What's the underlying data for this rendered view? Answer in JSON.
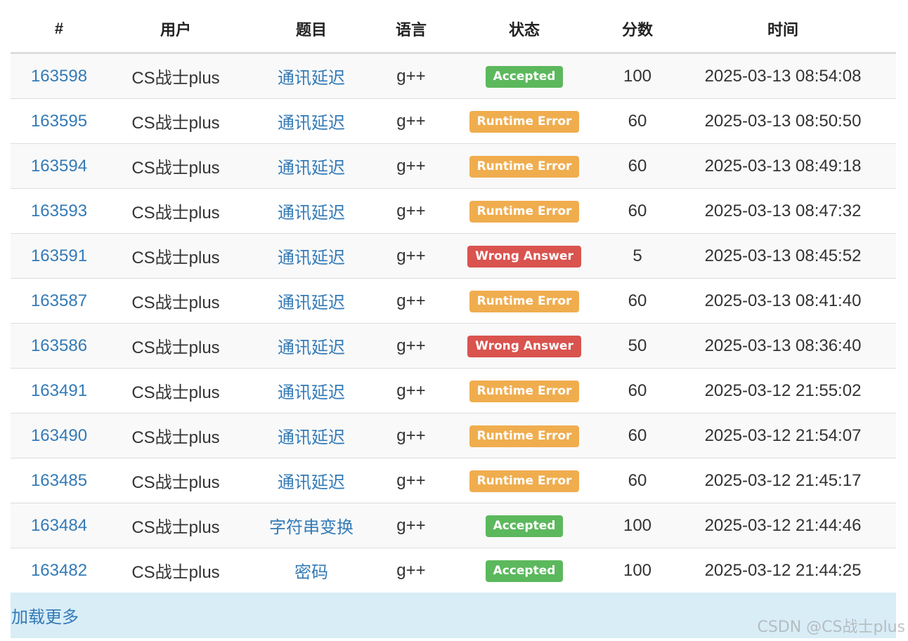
{
  "columns": [
    "#",
    "用户",
    "题目",
    "语言",
    "状态",
    "分数",
    "时间"
  ],
  "colors": {
    "Accepted": "#5cb85c",
    "Runtime Error": "#f0ad4e",
    "Wrong Answer": "#d9534f"
  },
  "rows": [
    {
      "id": "163598",
      "user": "CS战士plus",
      "problem": "通讯延迟",
      "lang": "g++",
      "status": "Accepted",
      "score": "100",
      "time": "2025-03-13 08:54:08"
    },
    {
      "id": "163595",
      "user": "CS战士plus",
      "problem": "通讯延迟",
      "lang": "g++",
      "status": "Runtime Error",
      "score": "60",
      "time": "2025-03-13 08:50:50"
    },
    {
      "id": "163594",
      "user": "CS战士plus",
      "problem": "通讯延迟",
      "lang": "g++",
      "status": "Runtime Error",
      "score": "60",
      "time": "2025-03-13 08:49:18"
    },
    {
      "id": "163593",
      "user": "CS战士plus",
      "problem": "通讯延迟",
      "lang": "g++",
      "status": "Runtime Error",
      "score": "60",
      "time": "2025-03-13 08:47:32"
    },
    {
      "id": "163591",
      "user": "CS战士plus",
      "problem": "通讯延迟",
      "lang": "g++",
      "status": "Wrong Answer",
      "score": "5",
      "time": "2025-03-13 08:45:52"
    },
    {
      "id": "163587",
      "user": "CS战士plus",
      "problem": "通讯延迟",
      "lang": "g++",
      "status": "Runtime Error",
      "score": "60",
      "time": "2025-03-13 08:41:40"
    },
    {
      "id": "163586",
      "user": "CS战士plus",
      "problem": "通讯延迟",
      "lang": "g++",
      "status": "Wrong Answer",
      "score": "50",
      "time": "2025-03-13 08:36:40"
    },
    {
      "id": "163491",
      "user": "CS战士plus",
      "problem": "通讯延迟",
      "lang": "g++",
      "status": "Runtime Error",
      "score": "60",
      "time": "2025-03-12 21:55:02"
    },
    {
      "id": "163490",
      "user": "CS战士plus",
      "problem": "通讯延迟",
      "lang": "g++",
      "status": "Runtime Error",
      "score": "60",
      "time": "2025-03-12 21:54:07"
    },
    {
      "id": "163485",
      "user": "CS战士plus",
      "problem": "通讯延迟",
      "lang": "g++",
      "status": "Runtime Error",
      "score": "60",
      "time": "2025-03-12 21:45:17"
    },
    {
      "id": "163484",
      "user": "CS战士plus",
      "problem": "字符串变换",
      "lang": "g++",
      "status": "Accepted",
      "score": "100",
      "time": "2025-03-12 21:44:46"
    },
    {
      "id": "163482",
      "user": "CS战士plus",
      "problem": "密码",
      "lang": "g++",
      "status": "Accepted",
      "score": "100",
      "time": "2025-03-12 21:44:25"
    }
  ],
  "load_more": "加载更多",
  "watermark": "CSDN @CS战士plus"
}
